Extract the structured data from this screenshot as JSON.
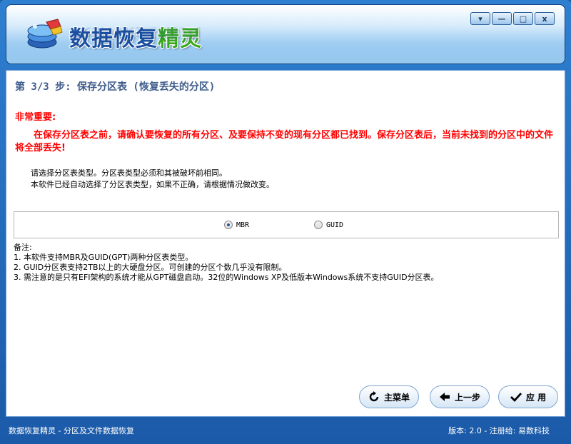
{
  "app": {
    "title_part1": "数据恢复",
    "title_part2": "精灵"
  },
  "window_controls": {
    "dropdown": "▾",
    "minimize": "—",
    "maximize": "□",
    "close": "x"
  },
  "step": {
    "title": "第 3/3 步: 保存分区表 (恢复丢失的分区)"
  },
  "warning": {
    "label": "非常重要:",
    "message": "在保存分区表之前，请确认要恢复的所有分区、及要保持不变的现有分区都已找到。保存分区表后，当前未找到的分区中的文件将全部丢失!"
  },
  "prompt": {
    "line1": "请选择分区表类型。分区表类型必须和其被破坏前相同。",
    "line2": "本软件已经自动选择了分区表类型，如果不正确，请根据情况做改变。"
  },
  "options": {
    "mbr": "MBR",
    "guid": "GUID",
    "selected": "MBR"
  },
  "notes": {
    "header": "备注:",
    "items": [
      "1. 本软件支持MBR及GUID(GPT)两种分区表类型。",
      "2. GUID分区表支持2TB以上的大硬盘分区。可创建的分区个数几乎没有限制。",
      "3. 需注意的是只有EFI架构的系统才能从GPT磁盘启动。32位的Windows XP及低版本Windows系统不支持GUID分区表。"
    ]
  },
  "buttons": {
    "main_menu": "主菜单",
    "back": "上一步",
    "apply": "应 用"
  },
  "status": {
    "left": "数据恢复精灵 - 分区及文件数据恢复",
    "right": "版本: 2.0 - 注册给: 易数科技"
  }
}
